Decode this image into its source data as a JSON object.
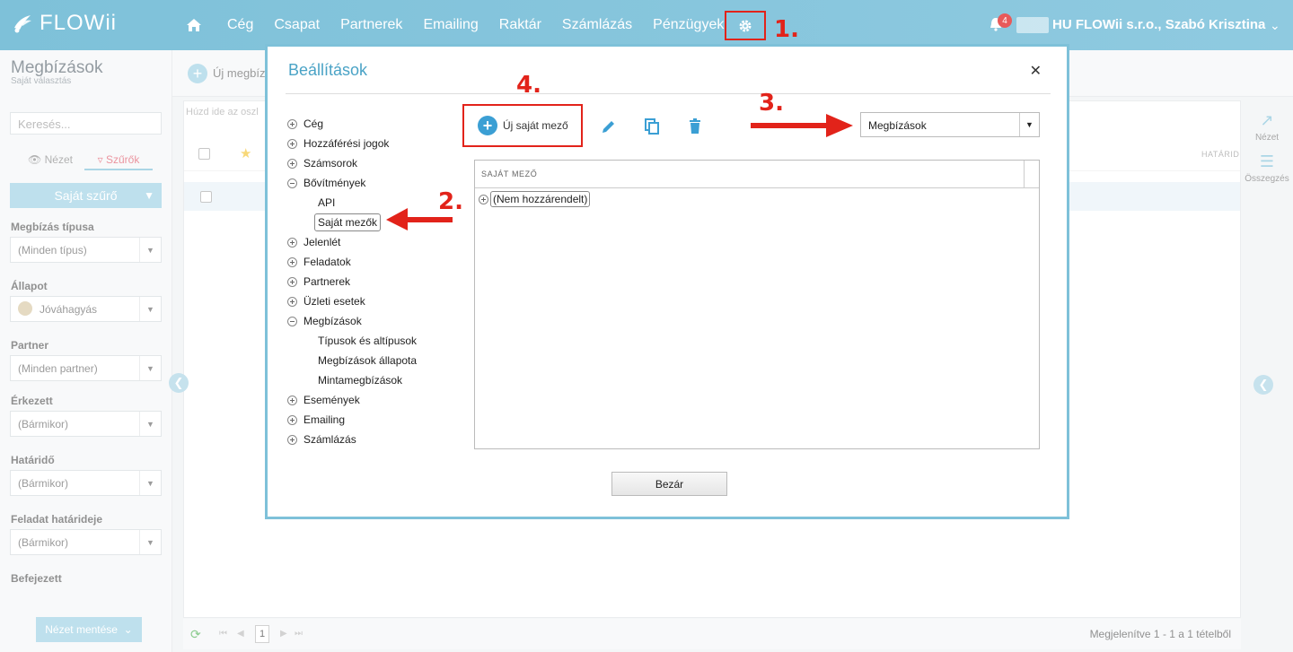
{
  "app": {
    "logo_text": "FLOWii",
    "nav_items": [
      "Cég",
      "Csapat",
      "Partnerek",
      "Emailing",
      "Raktár",
      "Számlázás",
      "Pénzügyek"
    ],
    "notification_count": "4",
    "user_label": "HU FLOWii s.r.o., Szabó Krisztina"
  },
  "annotations": {
    "step1": "1.",
    "step2": "2.",
    "step3": "3.",
    "step4": "4."
  },
  "sidebar": {
    "title": "Megbízások",
    "subtitle": "Saját választás",
    "search_placeholder": "Keresés...",
    "tab_view": "Nézet",
    "tab_filters": "Szűrők",
    "own_filter_button": "Saját szűrő",
    "filters": [
      {
        "label": "Megbízás típusa",
        "value": "(Minden típus)"
      },
      {
        "label": "Állapot",
        "value": "Jóváhagyás"
      },
      {
        "label": "Partner",
        "value": "(Minden partner)"
      },
      {
        "label": "Érkezett",
        "value": "(Bármikor)"
      },
      {
        "label": "Határidő",
        "value": "(Bármikor)"
      },
      {
        "label": "Feladat határideje",
        "value": "(Bármikor)"
      },
      {
        "label": "Befejezett",
        "value": ""
      }
    ],
    "save_view_button": "Nézet mentése"
  },
  "main": {
    "add_label": "Új megbízá",
    "drag_hint": "Húzd ide az oszl",
    "column_hatarido": "HATÁRID",
    "pager": {
      "page": "1",
      "info": "Megjelenítve 1 - 1 a 1 tételből"
    },
    "right_tools": [
      "Nézet",
      "Összegzés"
    ]
  },
  "modal": {
    "title": "Beállítások",
    "tree": [
      {
        "label": "Cég",
        "expanded": false
      },
      {
        "label": "Hozzáférési jogok",
        "expanded": false
      },
      {
        "label": "Számsorok",
        "expanded": false
      },
      {
        "label": "Bővítmények",
        "expanded": true
      },
      {
        "label": "API",
        "child": true
      },
      {
        "label": "Saját mezők",
        "child": true,
        "selected": true
      },
      {
        "label": "Jelenlét",
        "expanded": false
      },
      {
        "label": "Feladatok",
        "expanded": false
      },
      {
        "label": "Partnerek",
        "expanded": false
      },
      {
        "label": "Üzleti esetek",
        "expanded": false
      },
      {
        "label": "Megbízások",
        "expanded": true
      },
      {
        "label": "Típusok és altípusok",
        "child": true
      },
      {
        "label": "Megbízások állapota",
        "child": true
      },
      {
        "label": "Mintamegbízások",
        "child": true
      },
      {
        "label": "Események",
        "expanded": false
      },
      {
        "label": "Emailing",
        "expanded": false
      },
      {
        "label": "Számlázás",
        "expanded": false
      }
    ],
    "new_field_button": "Új saját mező",
    "entity_select": "Megbízások",
    "table_header": "SAJÁT MEZŐ",
    "table_row": "(Nem hozzárendelt)",
    "close_button": "Bezár"
  },
  "colors": {
    "topbar": "#7ec1d9",
    "accent": "#3b9fd4",
    "annotation_red": "#e2231a"
  }
}
